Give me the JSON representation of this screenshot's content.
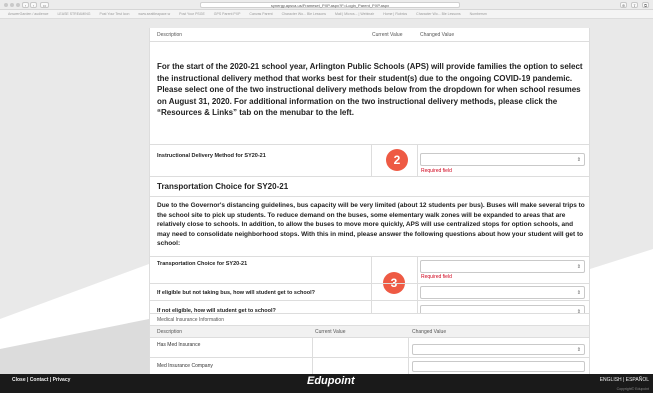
{
  "browser": {
    "url": "synergy.apsva.us/Frameset_PXP.aspx?F=Login_Parent_PXP.aspx",
    "bookmarks": [
      "AnswerGarden / audience",
      "LEASE STREAMING",
      "Post Your Test Icon",
      "www.seattleapace.w",
      "Post Your PSGE",
      "GPS Parent PXP",
      "Canvas Parent",
      "Character Wo... Ble Lessons",
      "Mail | Micros... | Webinair",
      "Home | Rubrics",
      "Character Wo... Ble Lessons",
      "Numbersm"
    ]
  },
  "table_header": {
    "description": "Description",
    "current_value": "Current Value",
    "changed_value": "Changed Value"
  },
  "intro_text": "For the start of the 2020-21 school year, Arlington Public Schools (APS) will provide families the option to select the instructional delivery method that works best for their student(s) due to the ongoing COVID-19 pandemic. Please select one of the two instructional delivery methods below from the dropdown for when school resumes on August 31, 2020. For additional information on the two instructional delivery methods, please click the “Resources & Links” tab on the menubar to the left.",
  "instructional": {
    "label": "Instructional Delivery Method for SY20-21",
    "required": "Required field",
    "badge": "2"
  },
  "transportation": {
    "title": "Transportation Choice for SY20-21",
    "text": "Due to the Governor's distancing guidelines, bus capacity will be very limited (about 12 students per bus). Buses will make several trips to the school site to pick up students. To reduce demand on the buses, some elementary walk zones will be expanded to areas that are relatively close to schools. In addition, to allow the buses to move more quickly, APS will use centralized stops for option schools, and may need to consolidate neighborhood stops. With this in mind, please answer the following questions about how your student will get to school:",
    "choice_label": "Transportation Choice for SY20-21",
    "required": "Required field",
    "badge": "3",
    "eligible_label": "If eligible but not taking bus, how will student get to school?",
    "not_eligible_label": "If not eligible, how will student get to school?"
  },
  "medical": {
    "section": "Medical Insurance Information",
    "description": "Description",
    "current_value": "Current Value",
    "changed_value": "Changed Value",
    "has_insurance": "Has Med Insurance",
    "company": "Med Insurance Company"
  },
  "footer": {
    "links": "Close  |  Contact  |  Privacy",
    "logo": "Edupoint",
    "language": "ENGLISH  |  ESPAÑOL",
    "copyright": "Copyright© Edupoint"
  },
  "colors": {
    "badge": "#ee5a44",
    "required": "#d0021b",
    "footer": "#1a1a1a"
  }
}
